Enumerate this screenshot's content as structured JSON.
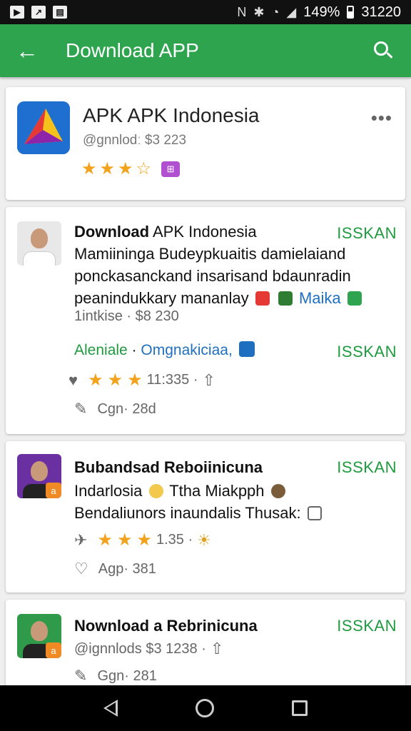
{
  "status_bar": {
    "battery_text": "149%",
    "time": "31220",
    "left_icons": [
      "photo-icon",
      "sync-icon",
      "download-icon"
    ]
  },
  "app_bar": {
    "title": "Download APP"
  },
  "featured": {
    "title": "APK APK Indonesia",
    "meta": "@gnnlodː $3 223",
    "rating_stars": 3,
    "rating_max": 4
  },
  "post1": {
    "name_bold": "Download",
    "name_rest": " APK Indonesia",
    "action": "ISSKAN",
    "desc_line1": "Mamiininga Budeypkuaitis damielaiand",
    "desc_line2": "ponckasanckand insarisand bdaunradin",
    "desc_line3": "peanindukkary mananlay",
    "desc_link": "Maika",
    "meta": "1intkise · $8 230",
    "link_green": "Aleniale",
    "link_sep": " · ",
    "link_blue": "Omgnakiciaa,",
    "action2": "ISSKAN",
    "stats": "11:335 ·",
    "comments": "Cgn· 28d"
  },
  "post2": {
    "name": "Bubandsad Reboiinicuna",
    "action": "ISSKAN",
    "line1_a": "Indarlosia",
    "line1_b": "Ttha Miakpph",
    "line2": "Bendaliunors inaundalis Thusak:",
    "stats": "1.35 ·",
    "likes": "Agp· 381"
  },
  "post3": {
    "name": "Nownload a Rebrinicuna",
    "action": "ISSKAN",
    "meta": "@ignnlods $3 1238 ·",
    "comments": "Ggn· 281"
  },
  "colors": {
    "accent": "#2ea44f",
    "action": "#1f9a3f",
    "star": "#f2a31b",
    "link": "#1f6fc0"
  }
}
